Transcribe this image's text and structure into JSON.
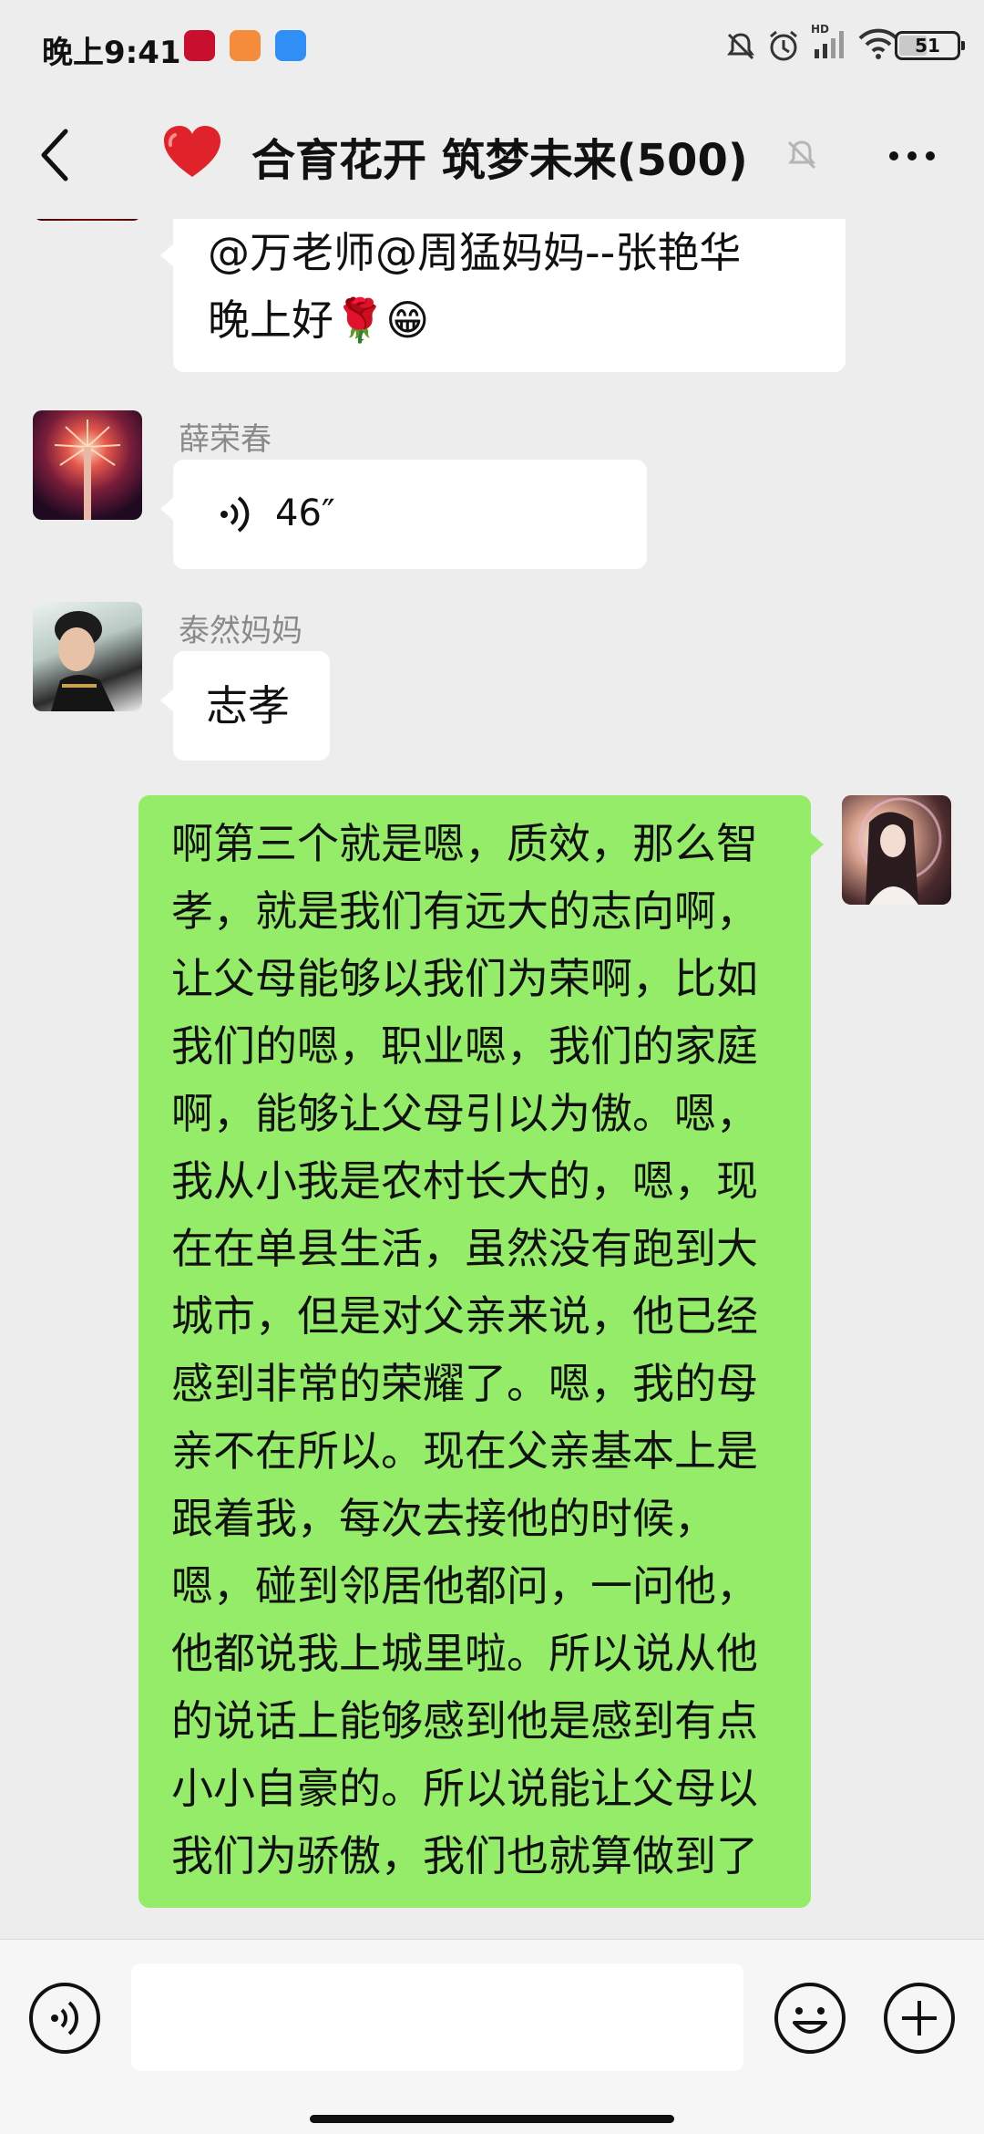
{
  "status_bar": {
    "time": "晚上9:41",
    "battery": "51",
    "battery_level": 0.51,
    "icons": [
      "app-xuexi-icon",
      "app-shop-icon",
      "app-blue-icon",
      "mute-notify-icon",
      "alarm-icon",
      "hd-signal-icon",
      "wifi-icon",
      "battery-icon"
    ]
  },
  "header": {
    "title": "合育花开 筑梦未来(500)",
    "icons": [
      "back-arrow-icon",
      "heart-icon",
      "mute-bell-icon",
      "more-dots-icon"
    ]
  },
  "messages": [
    {
      "id": "m1",
      "side": "left",
      "text": "@万老师@周猛妈妈--张艳华\n晚上好🌹😁"
    },
    {
      "id": "m2",
      "side": "left",
      "sender": "薛荣春",
      "type": "voice",
      "duration": "46″"
    },
    {
      "id": "m3",
      "side": "left",
      "sender": "泰然妈妈",
      "text": "志孝"
    },
    {
      "id": "m4",
      "side": "right",
      "text": "啊第三个就是嗯，质效，那么智孝，就是我们有远大的志向啊，让父母能够以我们为荣啊，比如我们的嗯，职业嗯，我们的家庭啊，能够让父母引以为傲。嗯，我从小我是农村长大的，嗯，现在在单县生活，虽然没有跑到大城市，但是对父亲来说，他已经感到非常的荣耀了。嗯，我的母亲不在所以。现在父亲基本上是跟着我，每次去接他的时候，嗯，碰到邻居他都问，一问他，他都说我上城里啦。所以说从他的说话上能够感到他是感到有点小小自豪的。所以说能让父母以我们为骄傲，我们也就算做到了"
    }
  ],
  "input_bar": {
    "placeholder": "",
    "icons": [
      "voice-input-icon",
      "emoji-icon",
      "plus-icon"
    ]
  },
  "colors": {
    "background": "#ededed",
    "bubble_mine": "#95ec69",
    "bubble_other": "#ffffff"
  }
}
